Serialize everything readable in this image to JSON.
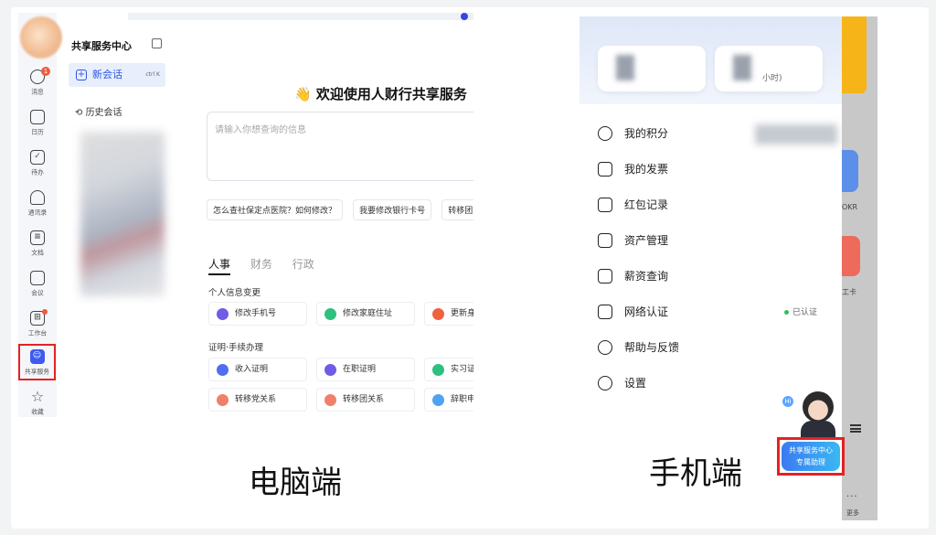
{
  "desktop": {
    "rail": [
      {
        "label": "消息",
        "icon": "message-icon",
        "badge": "1"
      },
      {
        "label": "日历",
        "icon": "calendar-icon"
      },
      {
        "label": "待办",
        "icon": "todo-check-icon"
      },
      {
        "label": "通讯录",
        "icon": "contacts-icon"
      },
      {
        "label": "文档",
        "icon": "document-icon"
      },
      {
        "label": "会议",
        "icon": "meeting-icon"
      },
      {
        "label": "工作台",
        "icon": "workbench-grid-icon"
      },
      {
        "label": "共享服务",
        "icon": "shared-service-icon"
      },
      {
        "label": "收藏",
        "icon": "star-icon"
      }
    ],
    "sidebar": {
      "title": "共享服务中心",
      "new_chat": "新会话",
      "shortcut": "ctrl K",
      "history": "历史会话"
    },
    "main": {
      "welcome": "👋 欢迎使用人财行共享服务",
      "input_placeholder": "请输入你想查询的信息",
      "quick_questions": [
        "怎么查社保定点医院？如何修改？",
        "我要修改银行卡号",
        "转移团关系"
      ],
      "tabs": [
        "人事",
        "财务",
        "行政"
      ],
      "sections": [
        {
          "title": "个人信息变更",
          "items": [
            "修改手机号",
            "修改家庭住址",
            "更新身"
          ]
        },
        {
          "title": "证明·手续办理",
          "items": [
            "收入证明",
            "在职证明",
            "实习证",
            "转移党关系",
            "转移团关系",
            "辞职申"
          ]
        }
      ]
    },
    "caption": "电脑端"
  },
  "mobile": {
    "card2_suffix": "小时)",
    "menu": [
      "我的积分",
      "我的发票",
      "红包记录",
      "资产管理",
      "薪资查询",
      "网络认证",
      "帮助与反馈",
      "设置"
    ],
    "verified": "已认证",
    "right_labels": [
      "OKR",
      "工卡",
      "更多"
    ],
    "hi": "Hi",
    "helper": {
      "line1": "共享服务中心",
      "line2": "专属助理"
    },
    "more_dots": "···",
    "caption": "手机端"
  },
  "colors": {
    "accent": "#2b55e6",
    "highlight": "#e32222",
    "badge": "#f05a3c",
    "verified": "#2fbf5a"
  }
}
